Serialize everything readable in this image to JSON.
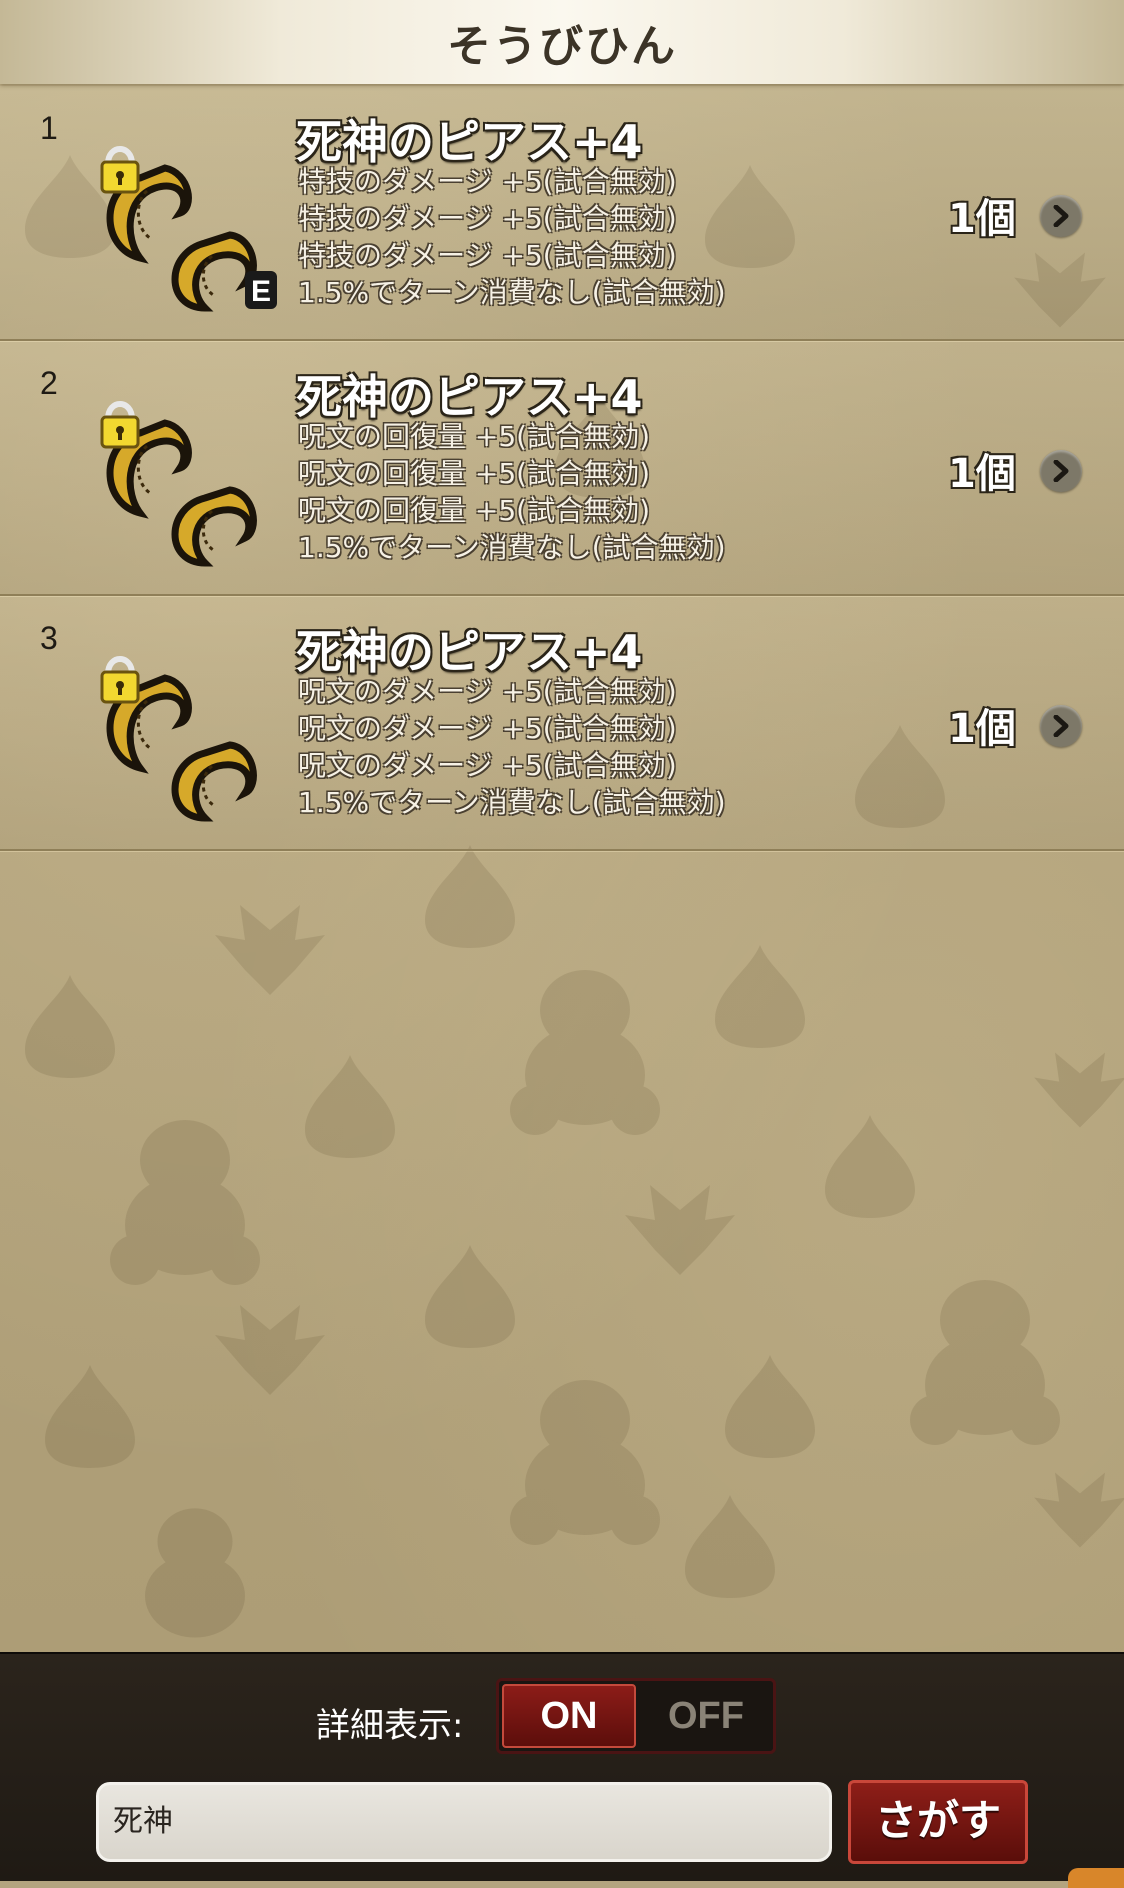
{
  "header": {
    "title": "そうびひん"
  },
  "items": [
    {
      "index": "1",
      "name": "死神のピアス+4",
      "effects": [
        "特技のダメージ +5(試合無効)",
        "特技のダメージ +5(試合無効)",
        "特技のダメージ +5(試合無効)",
        "1.5%でターン消費なし(試合無効)"
      ],
      "quantity": "1個",
      "locked": true,
      "equipped_badge": "E"
    },
    {
      "index": "2",
      "name": "死神のピアス+4",
      "effects": [
        "呪文の回復量 +5(試合無効)",
        "呪文の回復量 +5(試合無効)",
        "呪文の回復量 +5(試合無効)",
        "1.5%でターン消費なし(試合無効)"
      ],
      "quantity": "1個",
      "locked": true,
      "equipped_badge": ""
    },
    {
      "index": "3",
      "name": "死神のピアス+4",
      "effects": [
        "呪文のダメージ +5(試合無効)",
        "呪文のダメージ +5(試合無効)",
        "呪文のダメージ +5(試合無効)",
        "1.5%でターン消費なし(試合無効)"
      ],
      "quantity": "1個",
      "locked": true,
      "equipped_badge": ""
    }
  ],
  "footer": {
    "detail_label": "詳細表示:",
    "toggle_on": "ON",
    "toggle_off": "OFF",
    "toggle_selected": "ON",
    "search_value": "死神",
    "search_button": "さがす"
  },
  "colors": {
    "background": "#b4a47f",
    "footer": "#241e17",
    "accent_red": "#7a1612",
    "gold": "#d8ad2c"
  },
  "icons": [
    "earring-item-icon",
    "lock-icon",
    "chevron-right-icon"
  ]
}
